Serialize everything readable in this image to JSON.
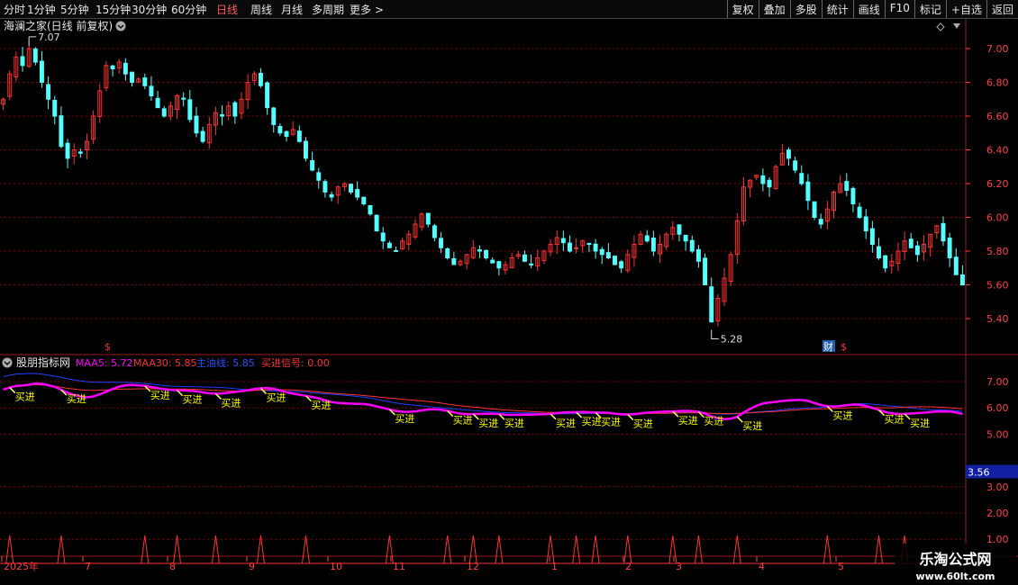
{
  "toolbar": {
    "periods": [
      "分时",
      "1分钟",
      "5分钟",
      "15分钟",
      "30分钟",
      "60分钟",
      "日线",
      "周线",
      "月线",
      "多周期",
      "更多 >"
    ],
    "active": "日线",
    "buttons": [
      "复权",
      "叠加",
      "多股",
      "统计",
      "画线",
      "F10",
      "标记",
      "+自选",
      "返回"
    ]
  },
  "main_chart": {
    "title": "海澜之家(日线 前复权)",
    "high_label": "7.07",
    "low_label": "5.28",
    "y_ticks": [
      "7.00",
      "6.80",
      "6.60",
      "6.40",
      "6.20",
      "6.00",
      "5.80",
      "5.60",
      "5.40"
    ],
    "markers": [
      "$",
      "财",
      "$"
    ]
  },
  "indicator": {
    "name": "股朋指标网",
    "maa5_label": "MAA5: 5.72",
    "maa30_label": "MAA30: 5.85",
    "main_label": "主油线: 5.85",
    "buy_signal_label": "买进信号: 0.00",
    "y_ticks": [
      "7.00",
      "6.00",
      "5.00",
      "3.00",
      "2.00",
      "1.00"
    ],
    "highlight_value": "3.56",
    "buy_text": "买进"
  },
  "x_axis": {
    "labels": [
      "2025年",
      "7",
      "8",
      "9",
      "10",
      "11",
      "12",
      "1",
      "2",
      "3",
      "4",
      "5"
    ]
  },
  "watermark": {
    "title": "乐淘公式网",
    "url": "www.60lt.com"
  },
  "colors": {
    "up": "#ff3232",
    "down": "#54ffff",
    "maa5": "#ff00ff",
    "maa30": "#ff3232",
    "main_line": "#2040ff",
    "signal": "#ff3232",
    "buy_text": "#ffff00",
    "grid": "#8b0000",
    "axis_text": "#ff4040"
  },
  "chart_data": {
    "type": "candlestick",
    "price_range": [
      5.28,
      7.07
    ],
    "closes": [
      6.7,
      6.85,
      6.95,
      6.9,
      7.0,
      6.92,
      6.8,
      6.7,
      6.6,
      6.42,
      6.35,
      6.4,
      6.38,
      6.45,
      6.6,
      6.75,
      6.9,
      6.88,
      6.92,
      6.85,
      6.8,
      6.82,
      6.78,
      6.72,
      6.65,
      6.6,
      6.66,
      6.72,
      6.7,
      6.58,
      6.5,
      6.45,
      6.55,
      6.62,
      6.6,
      6.66,
      6.6,
      6.7,
      6.8,
      6.85,
      6.78,
      6.65,
      6.55,
      6.5,
      6.48,
      6.52,
      6.45,
      6.35,
      6.28,
      6.22,
      6.15,
      6.12,
      6.18,
      6.2,
      6.15,
      6.12,
      6.08,
      6.02,
      5.92,
      5.86,
      5.82,
      5.8,
      5.86,
      5.9,
      5.96,
      6.02,
      5.96,
      5.88,
      5.82,
      5.76,
      5.72,
      5.74,
      5.78,
      5.82,
      5.8,
      5.76,
      5.73,
      5.7,
      5.72,
      5.76,
      5.78,
      5.74,
      5.72,
      5.76,
      5.8,
      5.84,
      5.88,
      5.85,
      5.8,
      5.82,
      5.86,
      5.84,
      5.8,
      5.78,
      5.76,
      5.72,
      5.7,
      5.78,
      5.84,
      5.9,
      5.86,
      5.8,
      5.84,
      5.9,
      5.94,
      5.9,
      5.86,
      5.8,
      5.74,
      5.6,
      5.38,
      5.52,
      5.64,
      5.78,
      5.98,
      6.18,
      6.22,
      6.25,
      6.2,
      6.18,
      6.3,
      6.38,
      6.35,
      6.28,
      6.2,
      6.1,
      6.0,
      5.96,
      6.05,
      6.15,
      6.2,
      6.16,
      6.08,
      6.0,
      5.92,
      5.84,
      5.76,
      5.7,
      5.74,
      5.8,
      5.86,
      5.82,
      5.78,
      5.84,
      5.9,
      5.95,
      5.86,
      5.76,
      5.66,
      5.6
    ],
    "maa5_last": 5.72,
    "maa30_last": 5.85,
    "main_line_last": 5.85,
    "buy_signal_last": 0.0
  }
}
